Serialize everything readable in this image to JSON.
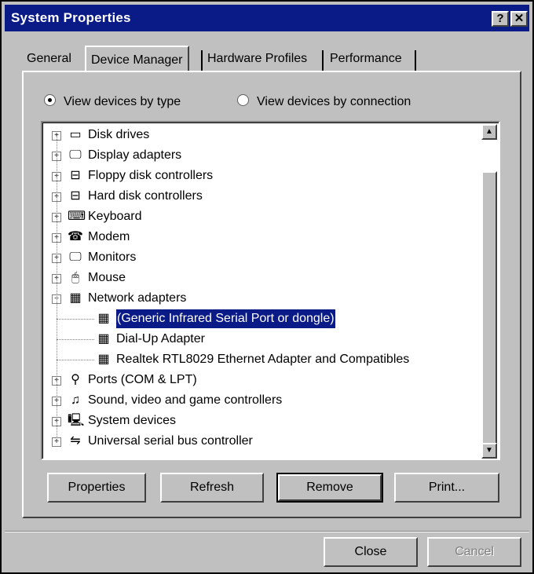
{
  "window": {
    "title": "System Properties",
    "help_glyph": "?",
    "close_glyph": "✕"
  },
  "tabs": [
    {
      "label": "General"
    },
    {
      "label": "Device Manager",
      "active": true
    },
    {
      "label": "Hardware Profiles"
    },
    {
      "label": "Performance"
    }
  ],
  "view": {
    "by_type_label": "View devices by type",
    "by_connection_label": "View devices by connection",
    "selected": "by_type"
  },
  "tree": [
    {
      "label": "Disk drives",
      "icon": "disk-drive-icon",
      "glyph": "▭",
      "expand": "+",
      "level": 0
    },
    {
      "label": "Display adapters",
      "icon": "monitor-icon",
      "glyph": "🖵",
      "expand": "+",
      "level": 0
    },
    {
      "label": "Floppy disk controllers",
      "icon": "floppy-controller-icon",
      "glyph": "⊟",
      "expand": "+",
      "level": 0
    },
    {
      "label": "Hard disk controllers",
      "icon": "hard-disk-controller-icon",
      "glyph": "⊟",
      "expand": "+",
      "level": 0
    },
    {
      "label": "Keyboard",
      "icon": "keyboard-icon",
      "glyph": "⌨",
      "expand": "+",
      "level": 0
    },
    {
      "label": "Modem",
      "icon": "modem-icon",
      "glyph": "☎",
      "expand": "+",
      "level": 0
    },
    {
      "label": "Monitors",
      "icon": "monitor-icon",
      "glyph": "🖵",
      "expand": "+",
      "level": 0
    },
    {
      "label": "Mouse",
      "icon": "mouse-icon",
      "glyph": "🖱",
      "expand": "+",
      "level": 0
    },
    {
      "label": "Network adapters",
      "icon": "network-adapter-icon",
      "glyph": "▦",
      "expand": "−",
      "level": 0
    },
    {
      "label": "(Generic Infrared Serial Port or dongle)",
      "icon": "network-adapter-icon",
      "glyph": "▦",
      "expand": "",
      "level": 1,
      "selected": true
    },
    {
      "label": "Dial-Up Adapter",
      "icon": "network-adapter-icon",
      "glyph": "▦",
      "expand": "",
      "level": 1
    },
    {
      "label": "Realtek RTL8029 Ethernet Adapter and Compatibles",
      "icon": "network-adapter-icon",
      "glyph": "▦",
      "expand": "",
      "level": 1
    },
    {
      "label": "Ports (COM & LPT)",
      "icon": "port-icon",
      "glyph": "⚲",
      "expand": "+",
      "level": 0
    },
    {
      "label": "Sound, video and game controllers",
      "icon": "sound-controller-icon",
      "glyph": "♫",
      "expand": "+",
      "level": 0
    },
    {
      "label": "System devices",
      "icon": "system-device-icon",
      "glyph": "🖳",
      "expand": "+",
      "level": 0
    },
    {
      "label": "Universal serial bus controller",
      "icon": "usb-icon",
      "glyph": "⇋",
      "expand": "+",
      "level": 0
    }
  ],
  "scroll": {
    "up_glyph": "▲",
    "down_glyph": "▼"
  },
  "buttons": {
    "properties": "Properties",
    "refresh": "Refresh",
    "remove": "Remove",
    "print": "Print...",
    "close": "Close",
    "cancel": "Cancel"
  },
  "colors": {
    "titlebar": "#0a1a86",
    "face": "#c0c0c0",
    "selection": "#0a1a86"
  }
}
